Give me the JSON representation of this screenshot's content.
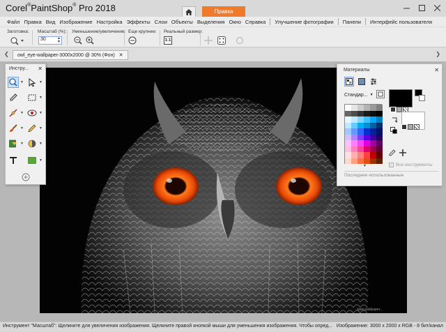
{
  "window": {
    "title_corel": "Corel",
    "title_paintshop": "PaintShop",
    "title_pro": "Pro 2018",
    "tab_home_icon": "home-icon",
    "tab_edit": "Правка"
  },
  "menu": [
    "Файл",
    "Правка",
    "Вид",
    "Изображение",
    "Настройка",
    "Эффекты",
    "Слои",
    "Объекты",
    "Выделения",
    "Окно",
    "Справка",
    "Улучшение фотографии",
    "Панели",
    "Интерфейс пользователя"
  ],
  "tool_options": {
    "presets_label": "Заготовка:",
    "zoom_label": "Масштаб (%):",
    "zoom_value": "30",
    "zoom_inout_label": "Уменьшение/увеличение:",
    "more_label": "Еще крупнее:",
    "actual_label": "Реальный размер:"
  },
  "document": {
    "tab_label": "owl_eye-wallpaper-3000x2000 @  30% (Фон)",
    "photo_credit": "www.wallpaper..."
  },
  "tools_panel": {
    "title": "Инстру..."
  },
  "materials": {
    "title": "Материалы",
    "palette_dropdown": "Стандар...",
    "all_tools_label": "Все инструменты",
    "recent_label": "Последние использованные",
    "foreground_color": "#000000",
    "background_color": "#ffffff",
    "accent_eye": "#ff5a10"
  },
  "status": {
    "left": "Инструмент \"Масштаб\": Щелкните для увеличения изображения. Щелкните правой кнопкой мыши для уменьшения изображения. Чтобы опред...",
    "right": "Изображение:  3000 x 2000 x RGB - 8 бит/канал"
  }
}
